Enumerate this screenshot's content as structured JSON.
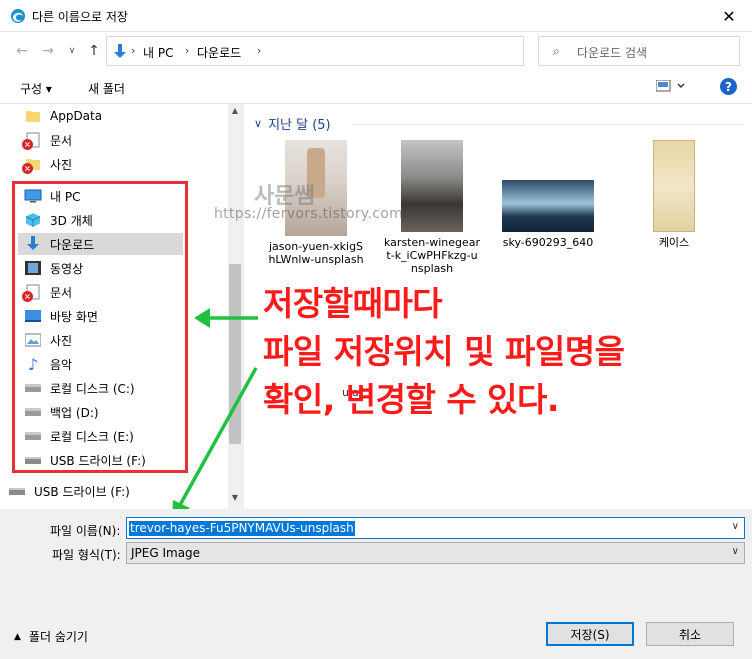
{
  "window": {
    "title": "다른 이름으로 저장"
  },
  "address": {
    "crumbs": [
      "내 PC",
      "다운로드"
    ],
    "search_placeholder": "다운로드 검색"
  },
  "toolbar": {
    "organize": "구성 ▾",
    "new_folder": "새 폴더",
    "help": "?"
  },
  "nav": {
    "items": [
      {
        "label": "AppData"
      },
      {
        "label": "문서"
      },
      {
        "label": "사진"
      },
      {
        "label": "내 PC"
      },
      {
        "label": "3D 개체"
      },
      {
        "label": "다운로드"
      },
      {
        "label": "동영상"
      },
      {
        "label": "문서"
      },
      {
        "label": "바탕 화면"
      },
      {
        "label": "사진"
      },
      {
        "label": "음악"
      },
      {
        "label": "로컬 디스크 (C:)"
      },
      {
        "label": "백업 (D:)"
      },
      {
        "label": "로컬 디스크 (E:)"
      },
      {
        "label": "USB 드라이브 (F:)"
      },
      {
        "label": "USB 드라이브 (F:)"
      }
    ]
  },
  "content": {
    "group_header": "지난 달 (5)",
    "files": [
      {
        "name": "jason-yuen-xkigShLWnlw-unsplash"
      },
      {
        "name": "karsten-winegeart-k_iCwPHFkzg-unsplash"
      },
      {
        "name": "sky-690293_640"
      },
      {
        "name": "케이스"
      }
    ],
    "fragment": "ula"
  },
  "watermark": {
    "url": "https://fervors.tistory.com",
    "logo": "사문쌤"
  },
  "annotation": {
    "lines": [
      "저장할때마다",
      "파일 저장위치 및 파일명을",
      "확인, 변경할 수 있다."
    ],
    "color": "#ff1a1a"
  },
  "bottom": {
    "filename_label": "파일 이름(N):",
    "filename_value": "trevor-hayes-Fu5PNYMAVUs-unsplash",
    "filetype_label": "파일 형식(T):",
    "filetype_value": "JPEG Image",
    "hide_folders": "폴더 숨기기",
    "save_label": "저장(S)",
    "cancel_label": "취소"
  },
  "colors": {
    "accent": "#0078d7",
    "highlight_box": "#e8303a",
    "group_header": "#1e3f8f"
  }
}
